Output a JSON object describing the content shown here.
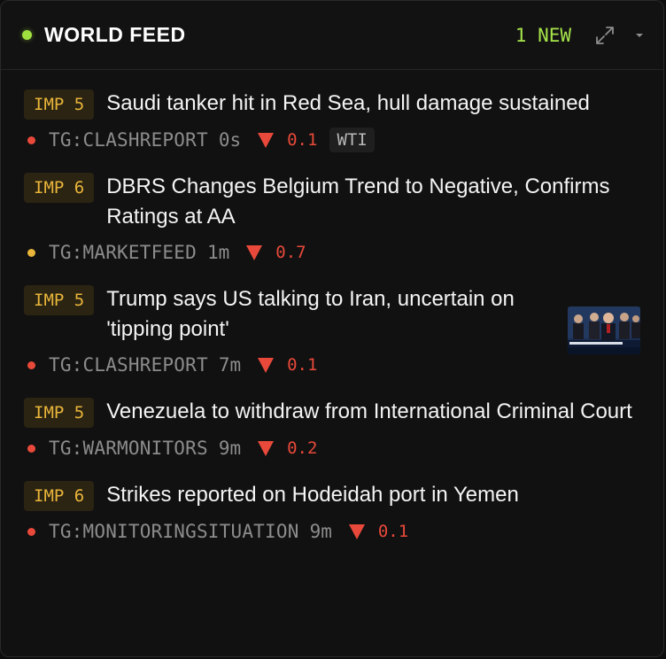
{
  "header": {
    "title": "WORLD FEED",
    "new_count": "1 NEW",
    "live_color": "#9ee03f",
    "accent": "#a6e44a"
  },
  "items": [
    {
      "imp": "IMP 5",
      "headline": "Saudi tanker hit in Red Sea, hull damage sustained",
      "source": "TG:CLASHREPORT",
      "age": "0s",
      "delta": "0.1",
      "tag": "WTI",
      "dot_color": "#e8493a",
      "has_thumb": false
    },
    {
      "imp": "IMP 6",
      "headline": "DBRS Changes Belgium Trend to Negative, Confirms Ratings at AA",
      "source": "TG:MARKETFEED",
      "age": "1m",
      "delta": "0.7",
      "dot_color": "#e9b53a",
      "has_thumb": false
    },
    {
      "imp": "IMP 5",
      "headline": "Trump says US talking to Iran, uncertain on 'tipping point'",
      "source": "TG:CLASHREPORT",
      "age": "7m",
      "delta": "0.1",
      "dot_color": "#e8493a",
      "has_thumb": true,
      "thumb_icon": "news-video-thumbnail"
    },
    {
      "imp": "IMP 5",
      "headline": "Venezuela to withdraw from International Criminal Court",
      "source": "TG:WARMONITORS",
      "age": "9m",
      "delta": "0.2",
      "dot_color": "#e8493a",
      "has_thumb": false
    },
    {
      "imp": "IMP 6",
      "headline": "Strikes reported on Hodeidah port in Yemen",
      "source": "TG:MONITORINGSITUATION",
      "age": "9m",
      "delta": "0.1",
      "dot_color": "#e8493a",
      "has_thumb": false
    }
  ],
  "icons": {
    "expand": "expand-icon",
    "chevron": "chevron-down-icon",
    "down": "triangle-down-icon"
  }
}
